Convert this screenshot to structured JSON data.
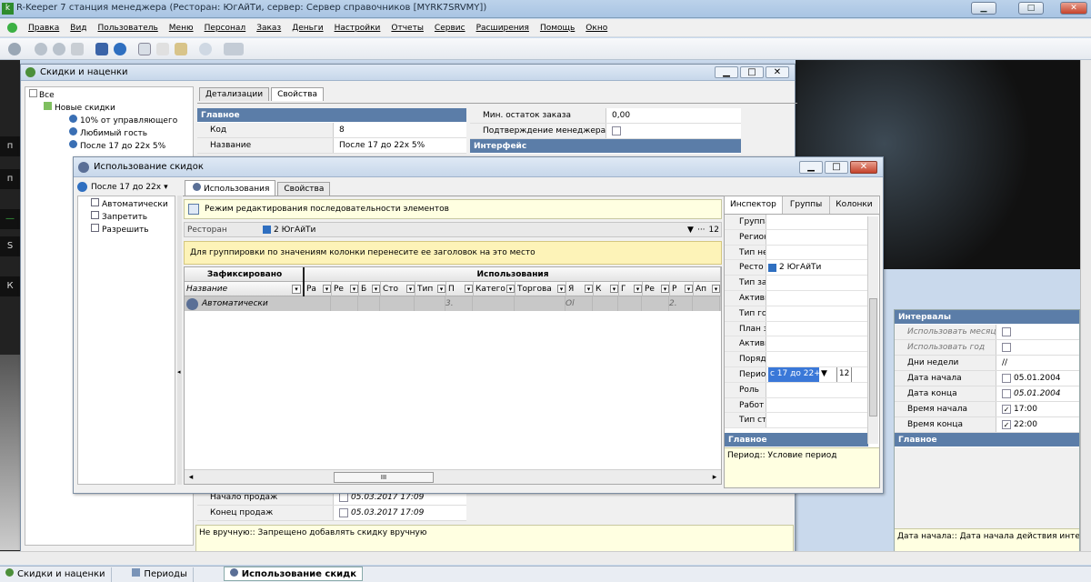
{
  "app": {
    "title": "R-Keeper 7 станция менеджера (Ресторан: ЮгАйТи, сервер: Сервер справочников [MYRK7SRVMY])",
    "icon_letter": "k"
  },
  "window_controls": {
    "min": "▁",
    "max": "□",
    "close": "✕"
  },
  "menu": [
    "Правка",
    "Вид",
    "Пользователь",
    "Меню",
    "Персонал",
    "Заказ",
    "Деньги",
    "Настройки",
    "Отчеты",
    "Сервис",
    "Расширения",
    "Помощь",
    "Окно"
  ],
  "desktop_left": [
    "п",
    "п",
    "—",
    "S",
    "К"
  ],
  "discounts_window": {
    "title": "Скидки и наценки",
    "tree": [
      "Все",
      "Новые скидки",
      "10% от управляющего",
      "Любимый гость",
      "После 17 до 22х 5%"
    ],
    "tabs": [
      "Детализации",
      "Свойства"
    ],
    "main_section": "Главное",
    "rows": [
      {
        "k": "Код",
        "v": "8"
      },
      {
        "k": "Название",
        "v": "После 17 до 22х 5%"
      }
    ],
    "right_rows": [
      {
        "k": "Мин. остаток заказа",
        "v": "0,00"
      },
      {
        "k": "Подтверждение менеджера",
        "v": ""
      }
    ],
    "interface_section": "Интерфейс",
    "bottom_rows": [
      {
        "k": "Начало продаж",
        "v": "05.03.2017 17:09"
      },
      {
        "k": "Конец продаж",
        "v": "05.03.2017 17:09"
      }
    ],
    "hint": "Не вручную:: Запрещено добавлять скидку вручную"
  },
  "usage_window": {
    "title": "Использование скидок",
    "selector": "После 17 до 22х",
    "tree": [
      "Автоматически",
      "Запретить",
      "Разрешить"
    ],
    "tabs": [
      "Использования",
      "Свойства"
    ],
    "edit_mode": "Режим редактирования последовательности элементов",
    "restaurant_label": "Ресторан",
    "restaurant_value": "2 ЮгАйТи",
    "restaurant_num": "12",
    "group_hint": "Для группировки по значениям колонки перенесите ее заголовок на это место",
    "fixed_header": "Зафиксировано",
    "usage_header": "Использования",
    "name_col": "Название",
    "cols": [
      "Ра",
      "Ре",
      "Б",
      "Сто",
      "Тип",
      "П",
      "Катего",
      "Торгова",
      "Я",
      "К",
      "Г",
      "Ре",
      "Р",
      "Ап"
    ],
    "row_name": "Автоматически",
    "row_cells": [
      "",
      "",
      "",
      "",
      "",
      "3.",
      "",
      "",
      "Ol",
      "",
      "",
      "",
      "2.",
      ""
    ],
    "scroll_mark": "III"
  },
  "inspector": {
    "tabs": [
      "Инспектор",
      "Группы",
      "Колонки"
    ],
    "rows": [
      "Группа",
      "Регион",
      "Тип не",
      "Ресто",
      "Тип за",
      "Активн",
      "Тип го",
      "План з",
      "Активн",
      "Поряд",
      "Перио",
      "Роль",
      "Работ",
      "Тип ст"
    ],
    "resto_value": "2 ЮгАйТи",
    "period_value": "с 17 до 22+",
    "period_num": "12",
    "section": "Главное",
    "hint": "Период:: Условие период"
  },
  "intervals": {
    "section": "Интервалы",
    "rows": [
      {
        "k": "Использовать месяц",
        "v": "",
        "check": false,
        "italic": true
      },
      {
        "k": "Использовать год",
        "v": "",
        "check": false,
        "italic": true
      },
      {
        "k": "Дни недели",
        "v": "//",
        "check": null,
        "italic": false
      },
      {
        "k": "Дата начала",
        "v": "05.01.2004",
        "check": false,
        "italic": false
      },
      {
        "k": "Дата конца",
        "v": "05.01.2004",
        "check": false,
        "italic": false
      },
      {
        "k": "Время начала",
        "v": "17:00",
        "check": true,
        "italic": false
      },
      {
        "k": "Время конца",
        "v": "22:00",
        "check": true,
        "italic": false
      }
    ],
    "main_section": "Главное",
    "hint": "Дата начала:: Дата начала действия интерва"
  },
  "taskbar": [
    "Скидки и наценки",
    "Периоды",
    "Использование скидк"
  ]
}
